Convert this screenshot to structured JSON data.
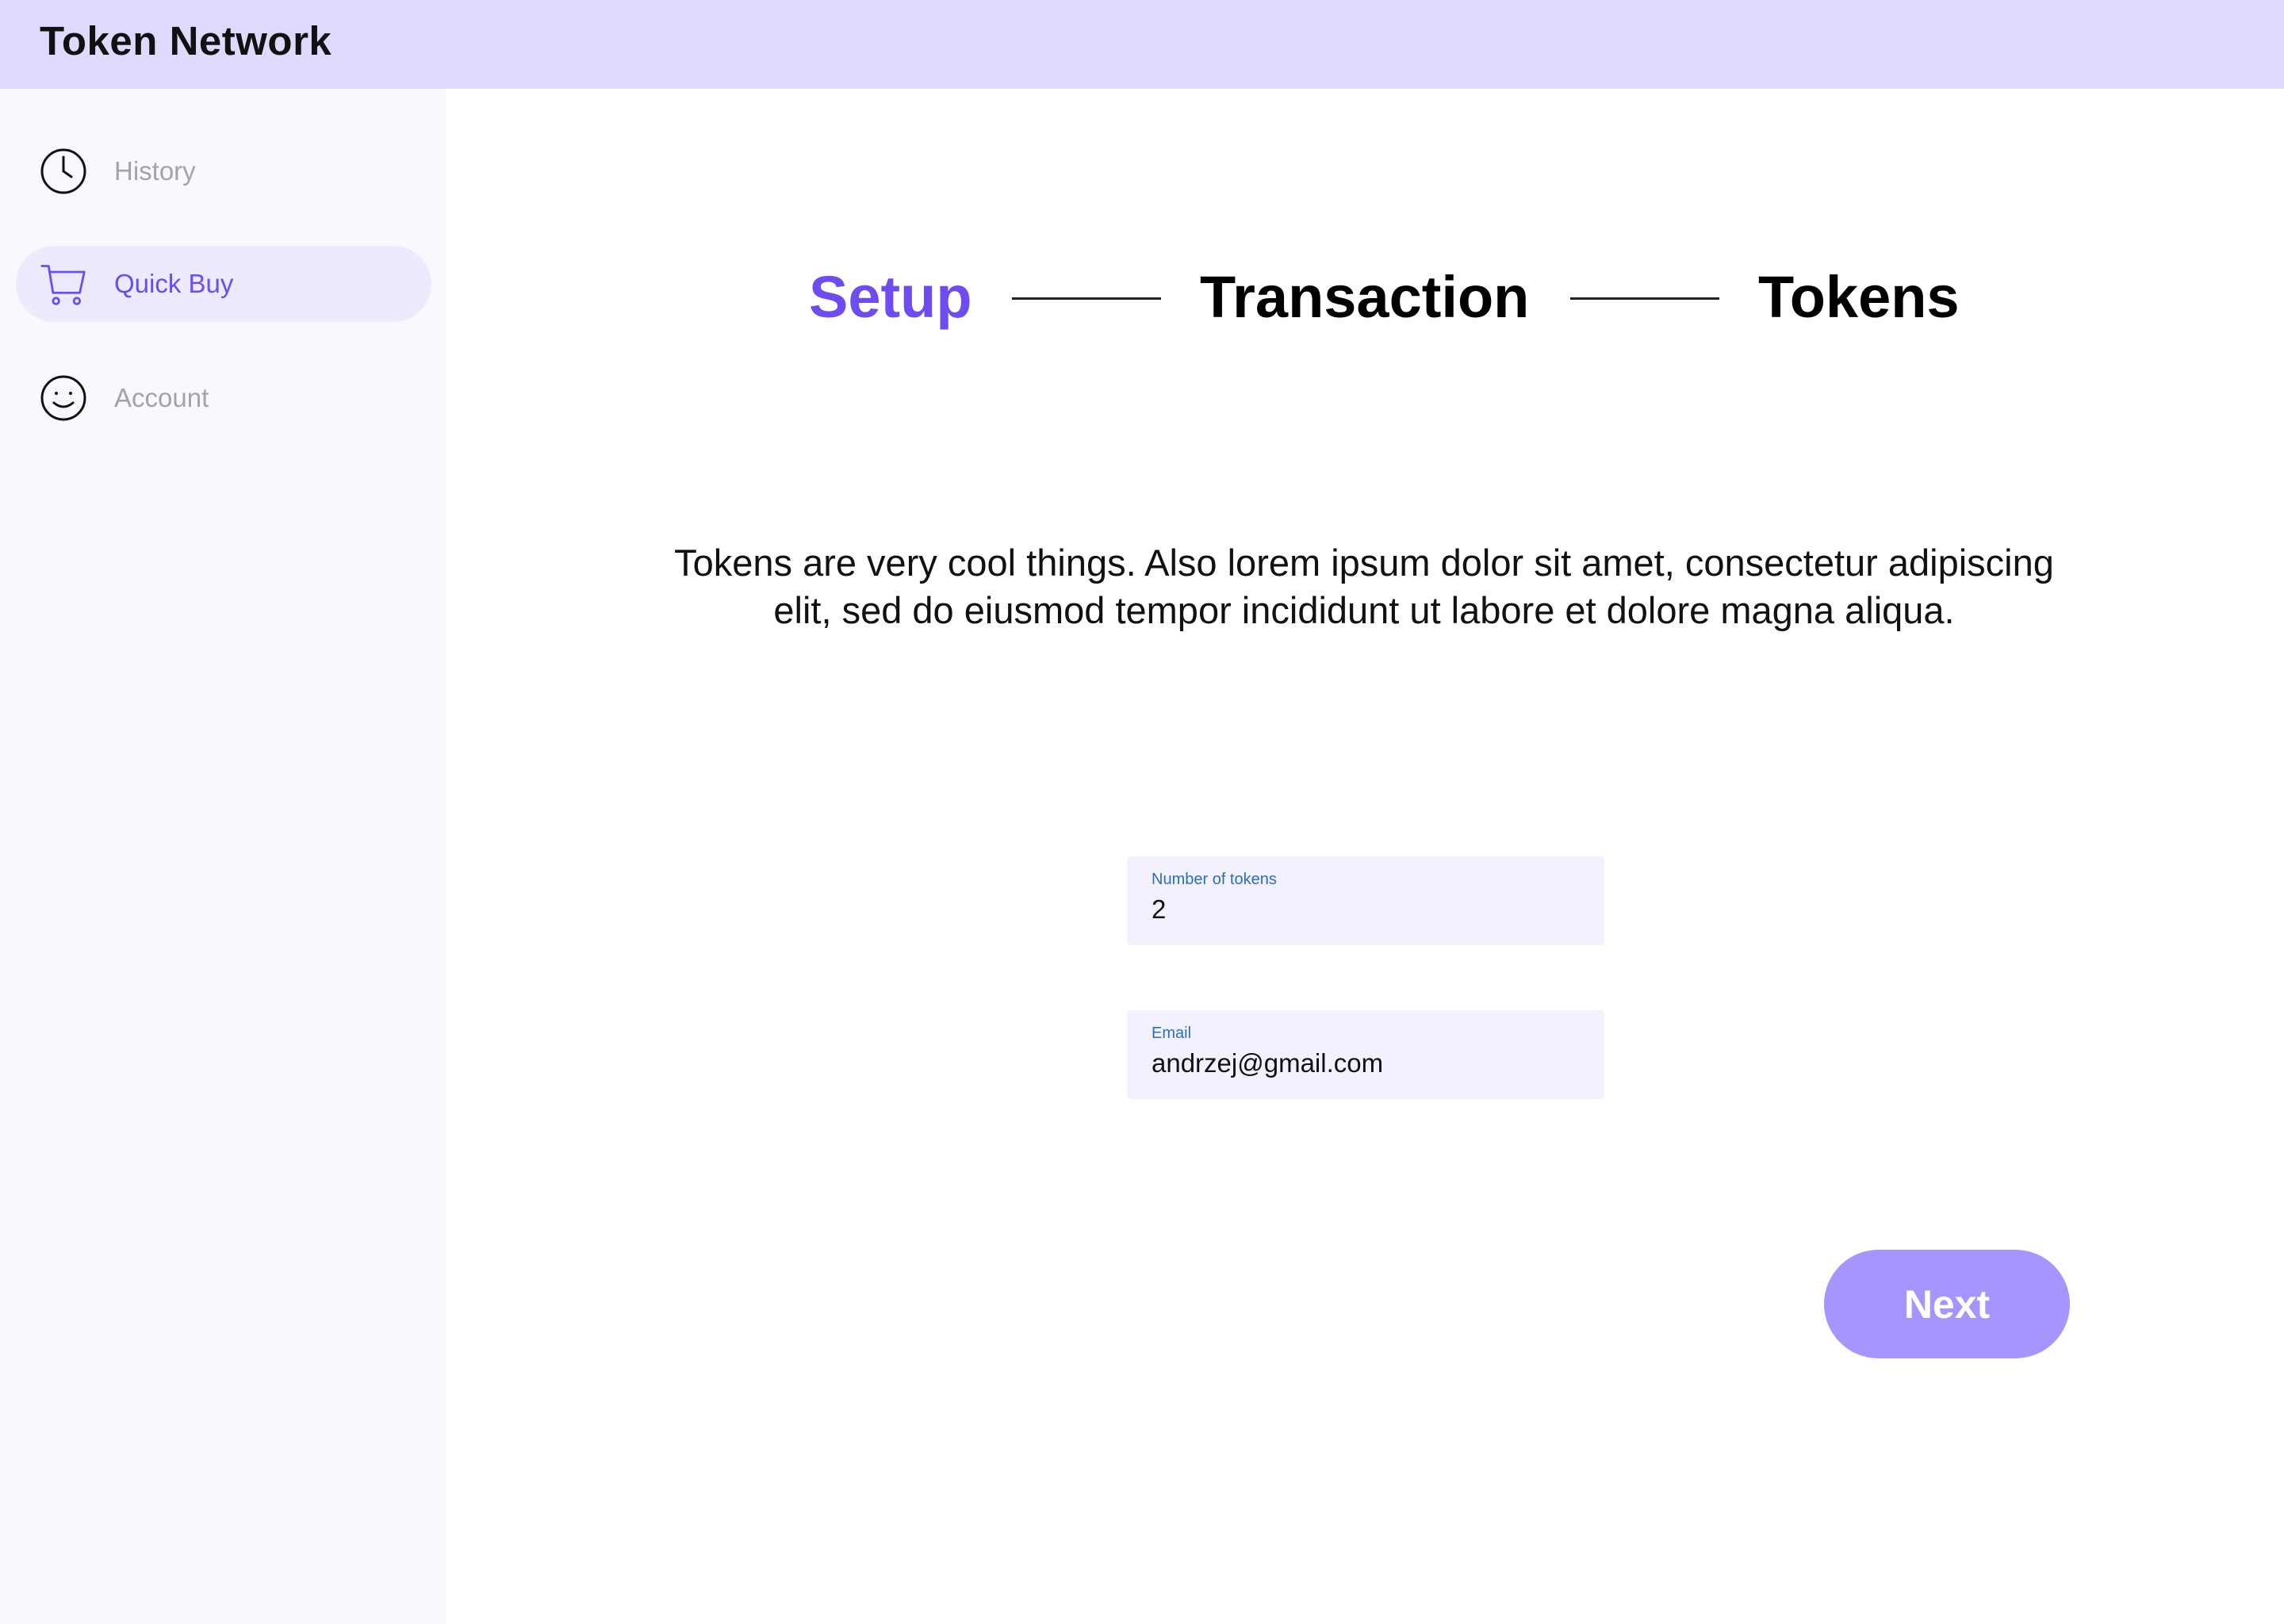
{
  "app": {
    "title": "Token Network"
  },
  "sidebar": {
    "items": [
      {
        "label": "History",
        "icon": "clock-icon",
        "active": false
      },
      {
        "label": "Quick Buy",
        "icon": "cart-icon",
        "active": true
      },
      {
        "label": "Account",
        "icon": "smiley-icon",
        "active": false
      }
    ]
  },
  "stepper": {
    "steps": [
      {
        "label": "Setup",
        "active": true
      },
      {
        "label": "Transaction",
        "active": false
      },
      {
        "label": "Tokens",
        "active": false
      }
    ]
  },
  "main": {
    "description": "Tokens are very cool things. Also lorem ipsum dolor sit amet, consectetur adipiscing elit, sed do eiusmod tempor incididunt ut labore et dolore magna aliqua."
  },
  "form": {
    "tokens": {
      "label": "Number of tokens",
      "value": "2"
    },
    "email": {
      "label": "Email",
      "value": "andrzej@gmail.com"
    }
  },
  "actions": {
    "next_label": "Next"
  },
  "colors": {
    "accent": "#6e4cf0",
    "topbar_bg": "#dedafe",
    "sidebar_bg": "#f9f8fe",
    "active_nav_bg": "#ecebfd",
    "field_bg": "#f3f1fe",
    "field_label": "#2a6ebd",
    "button_bg": "#a596fe"
  }
}
